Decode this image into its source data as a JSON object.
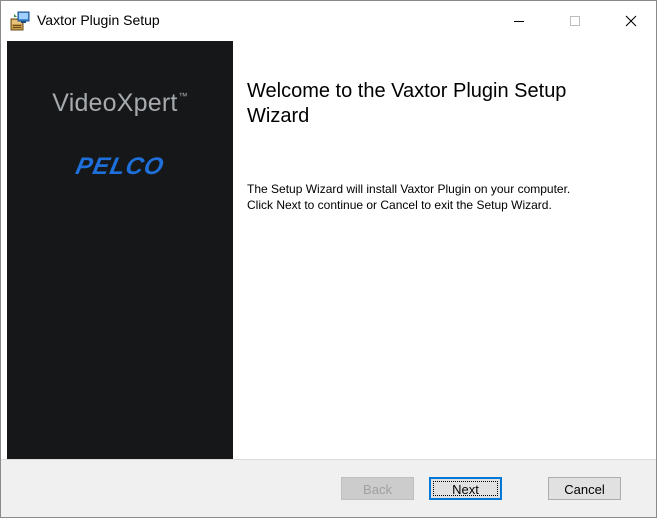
{
  "window": {
    "title": "Vaxtor Plugin Setup"
  },
  "titlebar": {
    "minimize_icon": "minimize-icon",
    "maximize_icon": "maximize-icon",
    "close_icon": "close-icon"
  },
  "banner": {
    "brand_name": "VideoXpert",
    "brand_mark": "™",
    "company_logo_text": "PELCO",
    "background_color": "#151719",
    "logo_color": "#1e6fd9"
  },
  "content": {
    "heading": "Welcome to the Vaxtor Plugin Setup Wizard",
    "description_line1": "The Setup Wizard will install Vaxtor Plugin on your computer.",
    "description_line2": "Click Next to continue or Cancel to exit the Setup Wizard."
  },
  "footer": {
    "back_label": "Back",
    "next_label": "Next",
    "cancel_label": "Cancel",
    "back_enabled": false
  }
}
